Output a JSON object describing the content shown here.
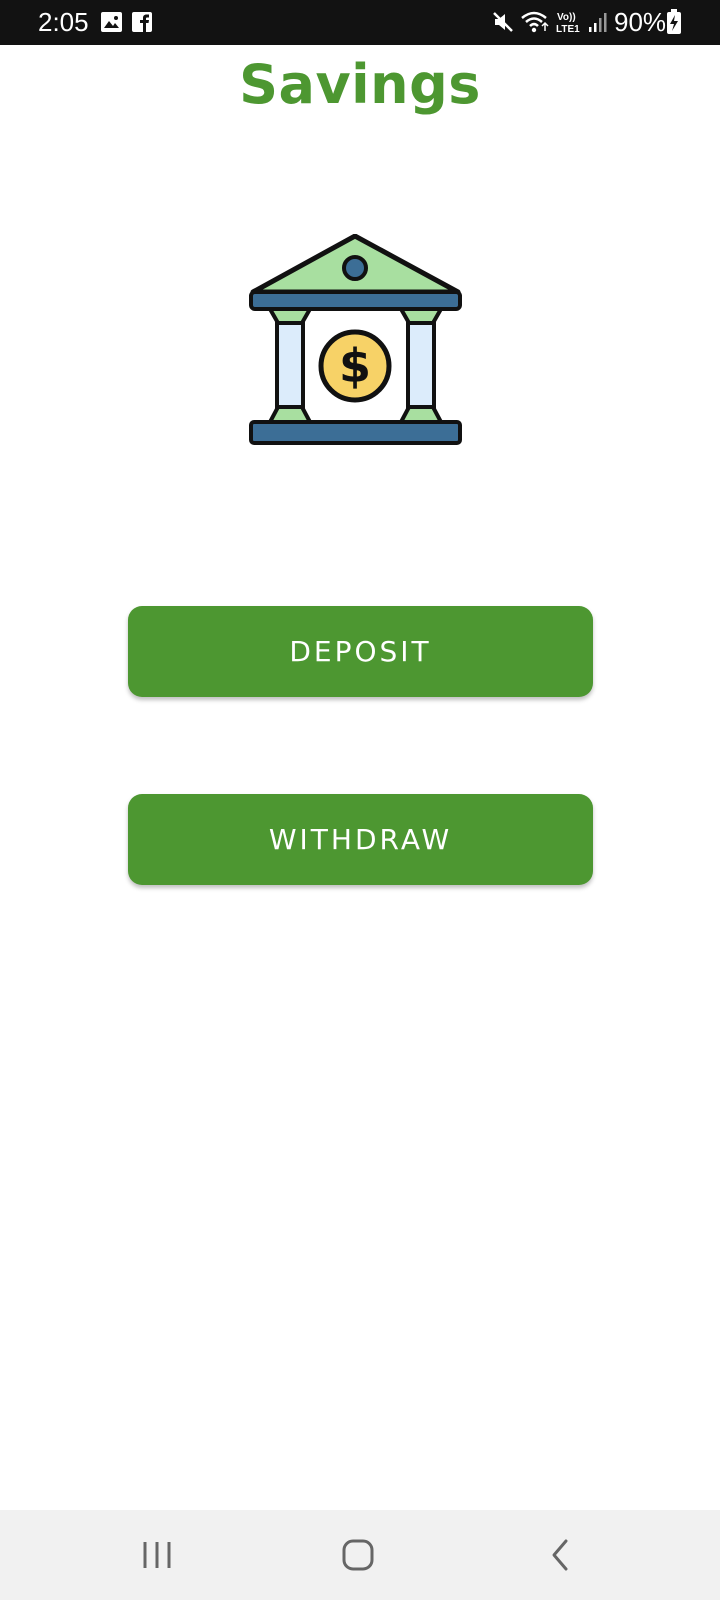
{
  "status_bar": {
    "time": "2:05",
    "battery": "90%",
    "icons": [
      "image-notification-icon",
      "facebook-icon",
      "mute-icon",
      "wifi-icon",
      "volte-lte-icon",
      "signal-icon",
      "battery-charging-icon"
    ],
    "network_top": "Vo))",
    "network_bottom": "LTE1"
  },
  "header": {
    "title": "Savings"
  },
  "main": {
    "illustration": "bank-icon",
    "buttons": {
      "deposit_label": "DEPOSIT",
      "withdraw_label": "WITHDRAW"
    }
  },
  "nav_bar": {
    "items": [
      "recent-apps-icon",
      "home-icon",
      "back-icon"
    ]
  },
  "colors": {
    "accent": "#4d9731",
    "status_bar_bg": "#121212",
    "nav_bar_bg": "#f1f1f1",
    "icon_green": "#a8dfa0",
    "icon_blue": "#3c6e96",
    "icon_coin": "#f7d267"
  }
}
